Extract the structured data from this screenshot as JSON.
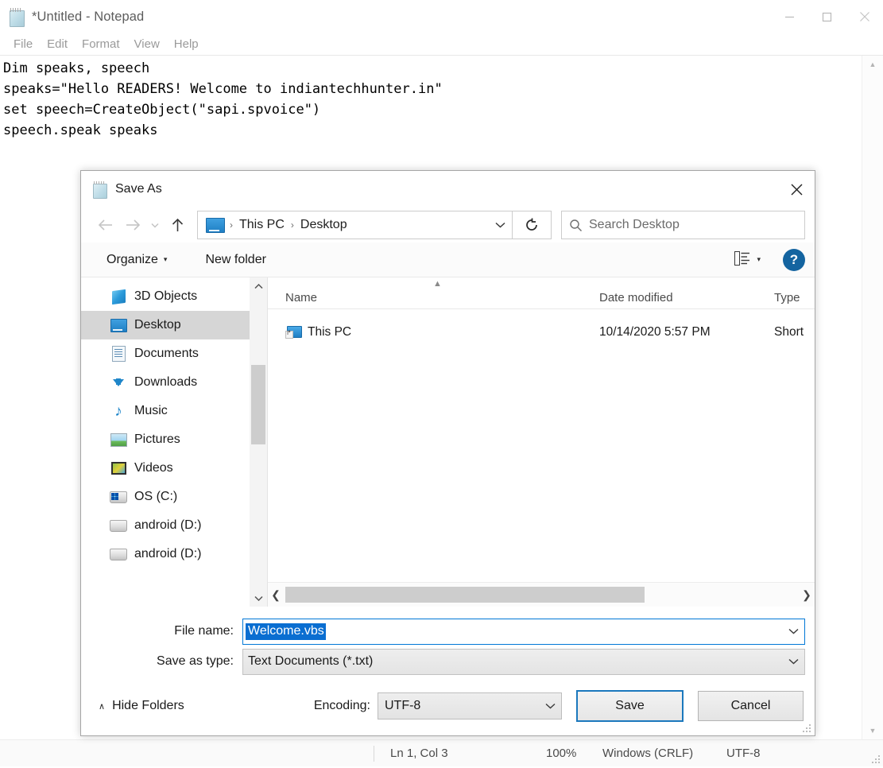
{
  "notepad": {
    "title": "*Untitled - Notepad",
    "app_icon": "notepad-icon",
    "menu": [
      {
        "label": "File"
      },
      {
        "label": "Edit"
      },
      {
        "label": "Format"
      },
      {
        "label": "View"
      },
      {
        "label": "Help"
      }
    ],
    "window_controls": {
      "minimize": "minimize-icon",
      "maximize": "maximize-icon",
      "close": "close-icon"
    },
    "document_text": "Dim speaks, speech\nspeaks=\"Hello READERS! Welcome to indiantechhunter.in\"\nset speech=CreateObject(\"sapi.spvoice\")\nspeech.speak speaks",
    "statusbar": {
      "position": "Ln 1, Col 3",
      "zoom": "100%",
      "line_ending": "Windows (CRLF)",
      "encoding": "UTF-8"
    }
  },
  "save_dialog": {
    "title": "Save As",
    "close_label": "✕",
    "nav": {
      "back": "back-arrow",
      "forward": "forward-arrow",
      "recent": "recent-caret",
      "up": "up-arrow",
      "refresh": "refresh-icon",
      "breadcrumbs": [
        {
          "label": "This PC"
        },
        {
          "label": "Desktop"
        }
      ],
      "separator": "›",
      "dropdown": "chevron-down-icon"
    },
    "search": {
      "icon": "search-icon",
      "placeholder": "Search Desktop"
    },
    "commandbar": {
      "organize": "Organize",
      "organize_caret": "▾",
      "new_folder": "New folder",
      "view_mode": "view-mode-icon",
      "view_caret": "▾",
      "help": "?"
    },
    "nav_pane": {
      "items": [
        {
          "label": "3D Objects",
          "icon": "3d-objects-icon",
          "selected": false
        },
        {
          "label": "Desktop",
          "icon": "desktop-icon",
          "selected": true
        },
        {
          "label": "Documents",
          "icon": "documents-icon",
          "selected": false
        },
        {
          "label": "Downloads",
          "icon": "downloads-icon",
          "selected": false
        },
        {
          "label": "Music",
          "icon": "music-icon",
          "selected": false
        },
        {
          "label": "Pictures",
          "icon": "pictures-icon",
          "selected": false
        },
        {
          "label": "Videos",
          "icon": "videos-icon",
          "selected": false
        },
        {
          "label": "OS (C:)",
          "icon": "drive-icon",
          "selected": false
        },
        {
          "label": "android (D:)",
          "icon": "drive-icon",
          "selected": false
        },
        {
          "label": "android (D:)",
          "icon": "drive-icon",
          "selected": false
        }
      ]
    },
    "file_list": {
      "columns": [
        {
          "label": "Name"
        },
        {
          "label": "Date modified"
        },
        {
          "label": "Type"
        }
      ],
      "rows": [
        {
          "name": "This PC",
          "date_modified": "10/14/2020 5:57 PM",
          "type": "Short",
          "icon": "this-pc-shortcut-icon"
        }
      ]
    },
    "form": {
      "filename_label": "File name:",
      "filename_value": "Welcome.vbs",
      "savetype_label": "Save as type:",
      "savetype_value": "Text Documents (*.txt)"
    },
    "footer": {
      "hide_folders": "Hide Folders",
      "hide_folders_caret": "∧",
      "encoding_label": "Encoding:",
      "encoding_value": "UTF-8",
      "save": "Save",
      "cancel": "Cancel"
    }
  },
  "colors": {
    "accent": "#0078d7",
    "selection": "#0a6ed1",
    "save_border": "#1b78bd",
    "help_blue": "#1464a0",
    "nav_selected": "#d6d6d6"
  }
}
